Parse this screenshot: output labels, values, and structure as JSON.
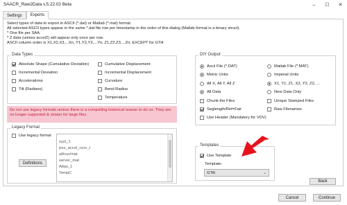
{
  "window": {
    "title": "SAACR_Raw2Data v.5.22.02 Beta",
    "minimize": "–",
    "maximize": "☐",
    "close": "✕"
  },
  "tabs": [
    {
      "label": "Settings"
    },
    {
      "label": "Exports"
    }
  ],
  "description": [
    "Select types of data to export in ASCII (*.dat) or Matlab (*.mat) format.",
    "All selected ASCII types appear in the same *.dat file row per timestamp in the order of this dialog (Matlab format is a binary struct).",
    "* One file per SAA.",
    "* Z data (unless accelZ) will appear only once per row.",
    "ASCII column order is X1,X2,X3,...Xn, Y1,Y2,Y3,...Yn, Z1,Z2,Z3,...Zn; EXCEPT for GTilt"
  ],
  "data_types": {
    "title": "Data Types",
    "left": [
      {
        "label": "Absolute Shape (Cumulative Deviation)",
        "checked": true
      },
      {
        "label": "Incremental Deviation",
        "checked": false
      },
      {
        "label": "Accelerations",
        "checked": false
      },
      {
        "label": "Tilt (Radians)",
        "checked": false
      }
    ],
    "right": [
      {
        "label": "Cumulative Displacement",
        "checked": false
      },
      {
        "label": "Incremental Displacement",
        "checked": false
      },
      {
        "label": "Curvature",
        "checked": false
      },
      {
        "label": "Bend Radius",
        "checked": false
      },
      {
        "label": "Temperature",
        "checked": false
      }
    ]
  },
  "warning": "Do not use legacy formats unless there is a compelling historical reason to do so. They are no longer supported & slower for large files.",
  "legacy": {
    "title": "Legacy Format",
    "use_label": "Use legacy format",
    "definitions_button": "Definitions",
    "list": [
      "xyzt_1",
      "pos_accel_curv_t",
      "all/cur/mat",
      "server_mat",
      "Atlas_1",
      "TempC"
    ]
  },
  "diy": {
    "title": "DIY Output",
    "left": [
      {
        "label": "Ascii File (*.DAT)",
        "type": "radio",
        "on": true
      },
      {
        "label": "Metric Units",
        "type": "radio",
        "on": true
      },
      {
        "label": "All X, All Y, All Z",
        "type": "radio",
        "on": false
      },
      {
        "label": "All Data",
        "type": "radio",
        "on": true
      },
      {
        "label": "Chunk the Files",
        "type": "check",
        "on": false
      },
      {
        "label": "Seglength/Ref=Fair",
        "type": "check",
        "on": true
      },
      {
        "label": "Use Header (Mandatory for VDV)",
        "type": "check",
        "on": false
      }
    ],
    "right": [
      {
        "label": "Matlab File (*.MAT)",
        "type": "radio",
        "on": false
      },
      {
        "label": "Imperial Units",
        "type": "radio",
        "on": false
      },
      {
        "label": "X1, Y1, Z1, X2, Y2, Z2, ...",
        "type": "radio",
        "on": true
      },
      {
        "label": "New Data Only",
        "type": "radio",
        "on": false
      },
      {
        "label": "Unique Stamped Files",
        "type": "check",
        "on": false
      },
      {
        "label": "Raw Filenames",
        "type": "check",
        "on": false
      }
    ]
  },
  "templates": {
    "title": "Templates",
    "use_label": "Use Template",
    "use_checked": true,
    "template_label": "Template:",
    "template_value": "GTilt"
  },
  "buttons": {
    "back": "Back",
    "cancel": "Cancel",
    "continue": "Continue"
  },
  "annotation_color": "#e8121c"
}
